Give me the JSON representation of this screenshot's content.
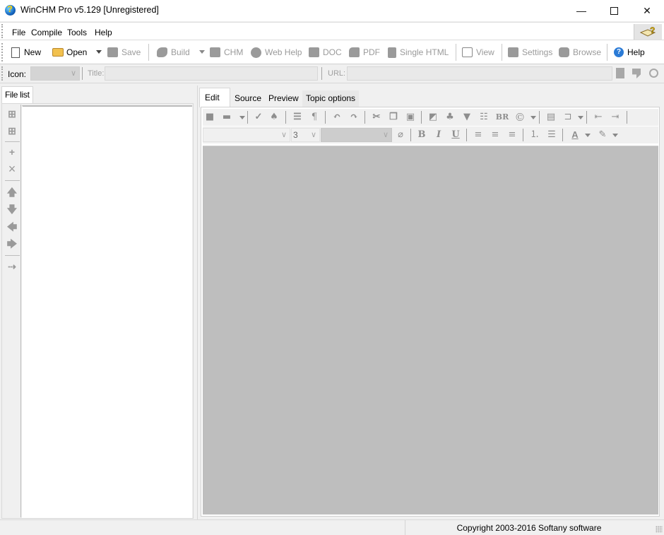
{
  "window": {
    "title": "WinCHM Pro v5.129 [Unregistered]",
    "app_icon": "winchm-globe-icon",
    "controls": {
      "minimize": "—",
      "maximize": "☐",
      "close": "✕"
    }
  },
  "menubar": {
    "items": [
      "File",
      "Compile",
      "Tools",
      "Help"
    ],
    "help_icon": "help-book-icon"
  },
  "toolbar": {
    "new": "New",
    "open": "Open",
    "save": "Save",
    "build": "Build",
    "chm": "CHM",
    "web_help": "Web Help",
    "doc": "DOC",
    "pdf": "PDF",
    "single_html": "Single HTML",
    "view": "View",
    "settings": "Settings",
    "browse": "Browse",
    "help": "Help"
  },
  "properties": {
    "icon_label": "Icon:",
    "icon_value": "",
    "title_label": "Title:",
    "title_value": "",
    "url_label": "URL:",
    "url_value": ""
  },
  "left_panel": {
    "tab": "File list",
    "tools": [
      "add-topic-icon",
      "add-subtopic-icon",
      "add-icon",
      "delete-icon",
      "move-up-icon",
      "move-down-icon",
      "move-left-icon",
      "move-right-icon",
      "add-new-link-icon"
    ]
  },
  "editor": {
    "tabs": [
      "Edit",
      "Source",
      "Preview",
      "Topic options"
    ],
    "active_tab": "Edit",
    "font_name": "",
    "font_size": "3",
    "style": "",
    "format_labels": {
      "br": "BR",
      "bold": "B",
      "italic": "I",
      "underline": "U",
      "pilcrow": "¶",
      "copyright": "©",
      "font_color": "A"
    }
  },
  "statusbar": {
    "left": "",
    "copyright": "Copyright 2003-2016 Softany software"
  }
}
